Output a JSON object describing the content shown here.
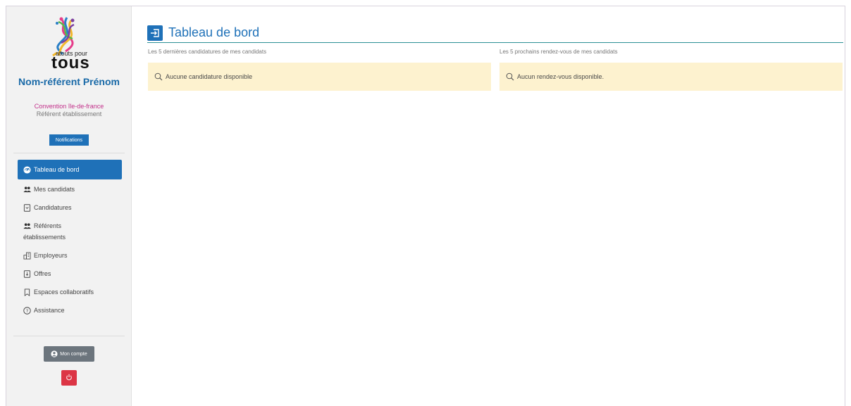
{
  "brand": {
    "small": "atouts pour",
    "big": "tous"
  },
  "user": {
    "name": "Nom-référent Prénom",
    "convention": "Convention île-de-france",
    "role": "Référent établissement",
    "notifications_label": "Notifications"
  },
  "nav": [
    {
      "label": "Tableau de bord",
      "icon": "dashboard-icon",
      "active": true
    },
    {
      "label": "Mes candidats",
      "icon": "users-icon"
    },
    {
      "label": "Candidatures",
      "icon": "document-icon"
    },
    {
      "label_line1": "Référents",
      "label_line2": "établissements",
      "icon": "users-icon"
    },
    {
      "label": "Employeurs",
      "icon": "building-icon"
    },
    {
      "label": "Offres",
      "icon": "document-icon"
    },
    {
      "label": "Espaces collaboratifs",
      "icon": "bookmark-icon"
    },
    {
      "label": "Assistance",
      "icon": "help-icon"
    }
  ],
  "account": {
    "label": "Mon compte",
    "logout_icon": "power-icon"
  },
  "main": {
    "title": "Tableau de bord",
    "title_icon": "sign-in-icon",
    "left": {
      "label": "Les 5 dernières candidatures de mes candidats",
      "empty": "Aucune candidature disponible"
    },
    "right": {
      "label": "Les 5 prochains rendez-vous de mes candidats",
      "empty": "Aucun rendez-vous disponible."
    }
  },
  "colors": {
    "primary": "#1f71b8",
    "accent_pink": "#c2308a",
    "empty_bg": "#fdf2cf",
    "danger": "#dc3545",
    "secondary": "#6c757d"
  }
}
